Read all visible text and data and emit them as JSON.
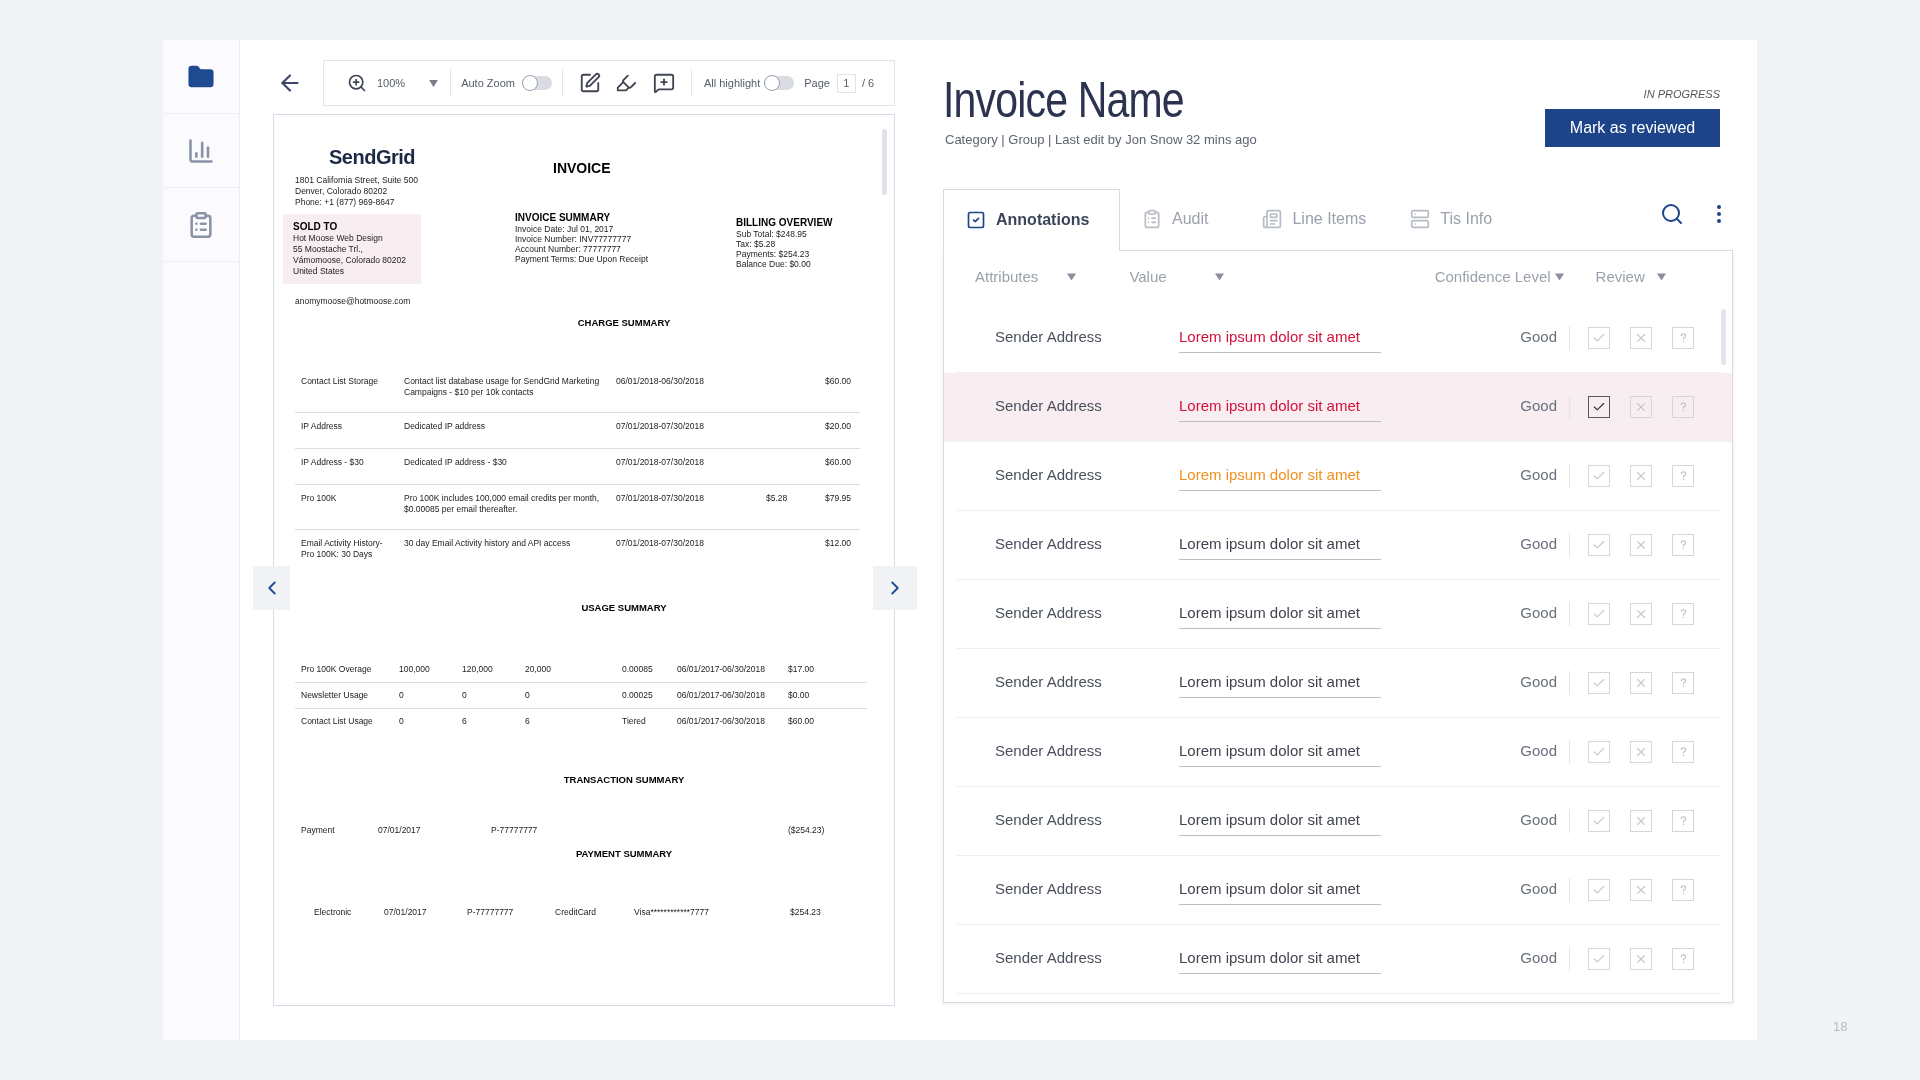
{
  "sidebar": {
    "items": [
      {
        "kind": "folder",
        "selected": true
      },
      {
        "kind": "chart",
        "selected": false
      },
      {
        "kind": "clipboard",
        "selected": false
      }
    ]
  },
  "toolbar": {
    "zoom": "100%",
    "auto_zoom": {
      "label": "Auto Zoom",
      "on": false
    },
    "all_highlight": {
      "label": "All highlight",
      "on": false
    },
    "page": {
      "label": "Page",
      "value": "1",
      "total": "/ 6"
    }
  },
  "document": {
    "logo": "SendGrid",
    "address": [
      "1801 California Street, Suite 500",
      "Denver, Colorado 80202",
      "Phone: +1 (877) 969-8647"
    ],
    "sold_to": {
      "heading": "SOLD TO",
      "lines": [
        "Hot Moose Web Design",
        "55 Moostache Trl.,",
        "Vámomoose, Colorado 80202",
        "United States"
      ]
    },
    "email": "anomymoose@hotmoose.com",
    "title": "INVOICE",
    "invoice_summary": {
      "heading": "INVOICE SUMMARY",
      "lines": [
        "Invoice Date: Jul 01, 2017",
        "Invoice Number: INV77777777",
        "Account Number: 77777777",
        "Payment Terms: Due Upon Receipt"
      ]
    },
    "billing_overview": {
      "heading": "BILLING OVERVIEW",
      "lines": [
        "Sub Total: $248.95",
        "Tax: $5.28",
        "Payments: $254.23",
        "Balance Due: $0.00"
      ]
    },
    "charge_summary": {
      "heading": "CHARGE SUMMARY",
      "rows": [
        [
          "Contact List Storage",
          "Contact list database usage for SendGrid Marketing Campaigns - $10 per 10k contacts",
          "06/01/2018-06/30/2018",
          "",
          "$60.00"
        ],
        [
          "IP Address",
          "Dedicated IP address",
          "07/01/2018-07/30/2018",
          "",
          "$20.00"
        ],
        [
          "IP Address - $30",
          "Dedicated IP address  - $30",
          "07/01/2018-07/30/2018",
          "",
          "$60.00"
        ],
        [
          "Pro 100K",
          "Pro 100K includes 100,000 email credits per month, $0.00085 per email thereafter.",
          "07/01/2018-07/30/2018",
          "$5.28",
          "$79.95"
        ],
        [
          "Email Activity History- Pro 100K: 30 Days",
          "30 day Email Activity history and API access",
          "07/01/2018-07/30/2018",
          "",
          "$12.00"
        ]
      ]
    },
    "usage_summary": {
      "heading": "USAGE SUMMARY",
      "rows": [
        [
          "Pro 100K Overage",
          "100,000",
          "120,000",
          "20,000",
          "0.00085",
          "06/01/2017-06/30/2018",
          "$17.00"
        ],
        [
          "Newsletter Usage",
          "0",
          "0",
          "0",
          "0.00025",
          "06/01/2017-06/30/2018",
          "$0.00"
        ],
        [
          "Contact List Usage",
          "0",
          "6",
          "6",
          "Tiered",
          "06/01/2017-06/30/2018",
          "$60.00"
        ]
      ]
    },
    "transaction_summary": {
      "heading": "TRANSACTION SUMMARY",
      "row": [
        "Payment",
        "07/01/2017",
        "P-77777777",
        "($254.23)"
      ]
    },
    "payment_summary": {
      "heading": "PAYMENT SUMMARY",
      "row": [
        "Electronic",
        "07/01/2017",
        "P-77777777",
        "CreditCard",
        "Visa************7777",
        "$254.23"
      ]
    }
  },
  "header": {
    "title": "Invoice Name",
    "meta": "Category | Group | Last edit by Jon Snow 32 mins ago",
    "status": "IN PROGRESS",
    "button": "Mark as reviewed"
  },
  "tabs": [
    {
      "label": "Annotations",
      "kind": "annotations",
      "selected": true
    },
    {
      "label": "Audit",
      "kind": "audit",
      "selected": false
    },
    {
      "label": "Line Items",
      "kind": "line_items",
      "selected": false
    },
    {
      "label": "Tis Info",
      "kind": "info",
      "selected": false
    }
  ],
  "table": {
    "columns": [
      "Attributes",
      "Value",
      "Confidence Level",
      "Review"
    ],
    "rows": [
      {
        "attribute": "Sender Address",
        "value": "Lorem ipsum dolor sit amet",
        "color": "#d4113c",
        "confidence": "Good",
        "selected": false,
        "approved": false
      },
      {
        "attribute": "Sender Address",
        "value": "Lorem ipsum dolor sit amet",
        "color": "#d4113c",
        "confidence": "Good",
        "selected": true,
        "approved": true
      },
      {
        "attribute": "Sender Address",
        "value": "Lorem ipsum dolor sit amet",
        "color": "#f0901e",
        "confidence": "Good",
        "selected": false,
        "approved": false
      },
      {
        "attribute": "Sender Address",
        "value": "Lorem ipsum dolor sit amet",
        "color": "#40444f",
        "confidence": "Good",
        "selected": false,
        "approved": false
      },
      {
        "attribute": "Sender Address",
        "value": "Lorem ipsum dolor sit amet",
        "color": "#40444f",
        "confidence": "Good",
        "selected": false,
        "approved": false
      },
      {
        "attribute": "Sender Address",
        "value": "Lorem ipsum dolor sit amet",
        "color": "#40444f",
        "confidence": "Good",
        "selected": false,
        "approved": false
      },
      {
        "attribute": "Sender Address",
        "value": "Lorem ipsum dolor sit amet",
        "color": "#40444f",
        "confidence": "Good",
        "selected": false,
        "approved": false
      },
      {
        "attribute": "Sender Address",
        "value": "Lorem ipsum dolor sit amet",
        "color": "#40444f",
        "confidence": "Good",
        "selected": false,
        "approved": false
      },
      {
        "attribute": "Sender Address",
        "value": "Lorem ipsum dolor sit amet",
        "color": "#40444f",
        "confidence": "Good",
        "selected": false,
        "approved": false
      },
      {
        "attribute": "Sender Address",
        "value": "Lorem ipsum dolor sit amet",
        "color": "#40444f",
        "confidence": "Good",
        "selected": false,
        "approved": false
      }
    ]
  },
  "page_number": "18"
}
